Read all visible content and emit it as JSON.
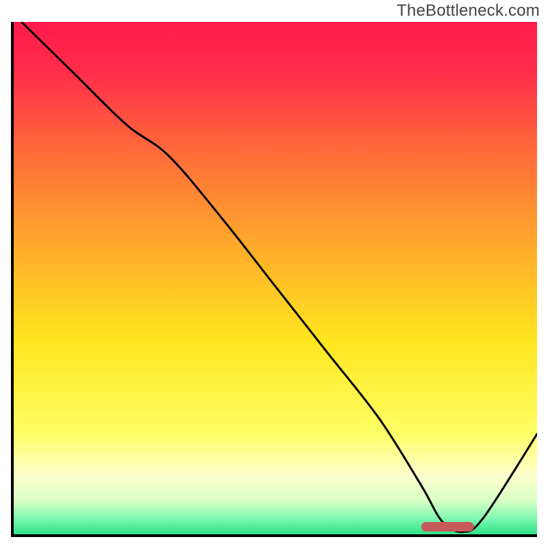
{
  "watermark": "TheBottleneck.com",
  "chart_data": {
    "type": "line",
    "title": "",
    "xlabel": "",
    "ylabel": "",
    "xlim": [
      0,
      100
    ],
    "ylim": [
      0,
      100
    ],
    "grid": false,
    "legend": false,
    "series": [
      {
        "name": "curve",
        "x": [
          2,
          12,
          22,
          30,
          40,
          50,
          60,
          70,
          78,
          82,
          86,
          90,
          100
        ],
        "y": [
          100,
          90,
          80,
          74,
          62,
          49,
          36,
          23,
          10,
          3,
          1,
          4,
          20
        ],
        "color": "#000000"
      }
    ],
    "marker": {
      "x_start": 78,
      "x_end": 88,
      "y": 2,
      "color": "#c65a5a"
    },
    "background_gradient": {
      "stops": [
        {
          "pos": 0.0,
          "color": "#ff1a4b"
        },
        {
          "pos": 0.1,
          "color": "#ff2e4a"
        },
        {
          "pos": 0.25,
          "color": "#ff6a3a"
        },
        {
          "pos": 0.45,
          "color": "#ffb02a"
        },
        {
          "pos": 0.62,
          "color": "#ffe61f"
        },
        {
          "pos": 0.8,
          "color": "#ffff66"
        },
        {
          "pos": 0.88,
          "color": "#fdffce"
        },
        {
          "pos": 0.93,
          "color": "#d8ffc5"
        },
        {
          "pos": 0.965,
          "color": "#7cf7b0"
        },
        {
          "pos": 1.0,
          "color": "#1fe07d"
        }
      ]
    }
  }
}
